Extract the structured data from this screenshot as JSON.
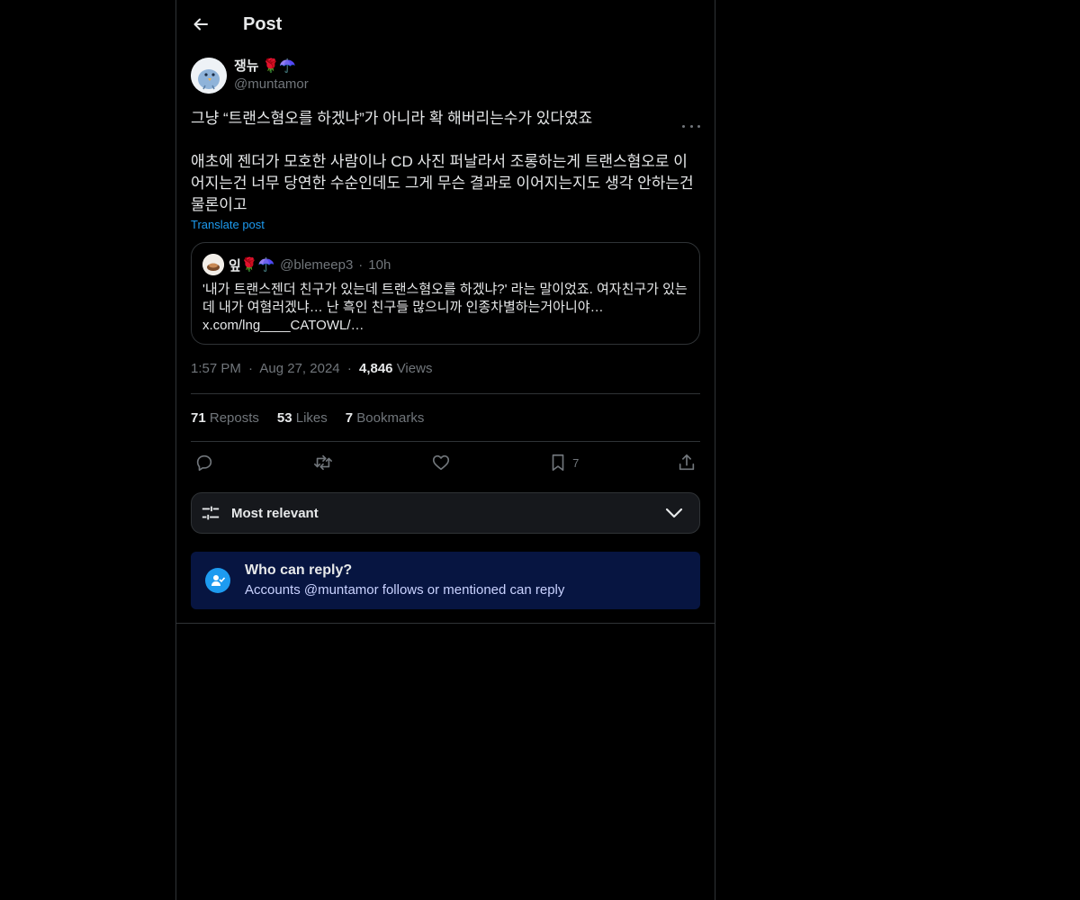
{
  "header": {
    "title": "Post"
  },
  "post": {
    "author_name": "쟁뉴",
    "author_emojis": "🌹☂️",
    "author_handle": "@muntamor",
    "text": "그냥 “트랜스혐오를 하겠냐”가 아니라 확 해버리는수가 있다였죠\n\n애초에 젠더가 모호한 사람이나 CD 사진 퍼날라서 조롱하는게 트랜스혐오로 이어지는건 너무 당연한 수순인데도 그게 무슨 결과로 이어지는지도 생각 안하는건 물론이고",
    "translate_label": "Translate post",
    "quote": {
      "name": "잎",
      "emojis": "🌹☂️",
      "handle": "@blemeep3",
      "separator": "·",
      "time": "10h",
      "text": "'내가 트랜스젠더 친구가 있는데 트랜스혐오를 하겠냐?' 라는 말이었죠. 여자친구가 있는데 내가 여혐러겠냐… 난 흑인 친구들 많으니까 인종차별하는거아니야…\nx.com/lng____CATOWL/…"
    },
    "meta": {
      "time": "1:57 PM",
      "sep": "·",
      "date": "Aug 27, 2024",
      "views_count": "4,846",
      "views_label": "Views"
    },
    "stats": {
      "reposts_count": "71",
      "reposts_label": "Reposts",
      "likes_count": "53",
      "likes_label": "Likes",
      "bookmarks_count": "7",
      "bookmarks_label": "Bookmarks"
    },
    "actions": {
      "bookmark_count": "7"
    }
  },
  "sort": {
    "label": "Most relevant"
  },
  "reply_restriction": {
    "title": "Who can reply?",
    "subtitle": "Accounts @muntamor follows or mentioned can reply"
  },
  "icons": [
    "back-arrow-icon",
    "more-icon",
    "reply-icon",
    "repost-icon",
    "like-icon",
    "bookmark-icon",
    "share-icon",
    "sliders-icon",
    "chevron-down-icon",
    "person-check-icon"
  ]
}
